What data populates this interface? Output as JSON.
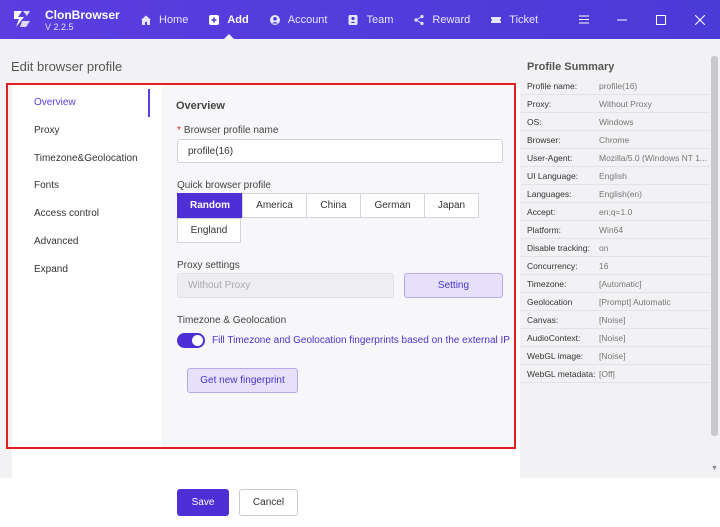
{
  "header": {
    "app_name": "ClonBrowser",
    "version": "V 2.2.5",
    "nav": [
      {
        "label": "Home",
        "icon": "home-icon"
      },
      {
        "label": "Add",
        "icon": "plus-square-icon"
      },
      {
        "label": "Account",
        "icon": "user-circle-icon"
      },
      {
        "label": "Team",
        "icon": "team-icon"
      },
      {
        "label": "Reward",
        "icon": "share-icon"
      },
      {
        "label": "Ticket",
        "icon": "ticket-icon"
      }
    ],
    "window_controls": [
      "menu-icon",
      "minimize-icon",
      "maximize-icon",
      "close-icon"
    ]
  },
  "page": {
    "title": "Edit browser profile"
  },
  "sidebar": {
    "items": [
      {
        "label": "Overview",
        "active": true
      },
      {
        "label": "Proxy"
      },
      {
        "label": "Timezone&Geolocation"
      },
      {
        "label": "Fonts"
      },
      {
        "label": "Access control"
      },
      {
        "label": "Advanced"
      },
      {
        "label": "Expand"
      }
    ]
  },
  "form": {
    "section_title": "Overview",
    "name_label": "Browser profile name",
    "name_value": "profile(16)",
    "quick_label": "Quick browser profile",
    "quick_options": [
      "Random",
      "America",
      "China",
      "German",
      "Japan",
      "England"
    ],
    "quick_selected": "Random",
    "proxy_label": "Proxy settings",
    "proxy_placeholder": "Without Proxy",
    "proxy_button": "Setting",
    "tz_label": "Timezone & Geolocation",
    "tz_toggle_label": "Fill Timezone and Geolocation fingerprints based on the external IP",
    "tz_toggle_on": true,
    "fingerprint_button": "Get new fingerprint"
  },
  "footer": {
    "save": "Save",
    "cancel": "Cancel"
  },
  "summary": {
    "title": "Profile Summary",
    "rows": [
      {
        "key": "Profile name:",
        "value": "profile(16)"
      },
      {
        "key": "Proxy:",
        "value": "Without Proxy"
      },
      {
        "key": "OS:",
        "value": "Windows"
      },
      {
        "key": "Browser:",
        "value": "Chrome"
      },
      {
        "key": "User-Agent:",
        "value": "Mozilla/5.0 (Windows NT 1..."
      },
      {
        "key": "UI Language:",
        "value": "English"
      },
      {
        "key": "Languages:",
        "value": "English(en)"
      },
      {
        "key": "Accept:",
        "value": "en;q=1.0"
      },
      {
        "key": "Platform:",
        "value": "Win64"
      },
      {
        "key": "Disable tracking:",
        "value": "on"
      },
      {
        "key": "Concurrency:",
        "value": "16"
      },
      {
        "key": "Timezone:",
        "value": "[Automatic]"
      },
      {
        "key": "Geolocation",
        "value": "[Prompt] Automatic"
      },
      {
        "key": "Canvas:",
        "value": "[Noise]"
      },
      {
        "key": "AudioContext:",
        "value": "[Noise]"
      },
      {
        "key": "WebGL image:",
        "value": "[Noise]"
      },
      {
        "key": "WebGL metadata:",
        "value": "[Off]"
      }
    ]
  },
  "colors": {
    "accent": "#4e2fd6",
    "header": "#4b3bd6",
    "highlight": "#e02020"
  }
}
